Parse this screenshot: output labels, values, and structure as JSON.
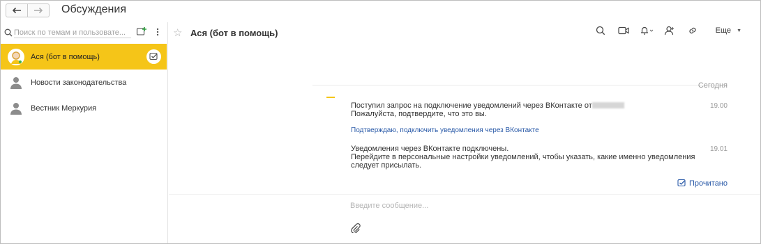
{
  "window": {
    "title": "Обсуждения",
    "back_label": "🡐",
    "forward_label": "🡒"
  },
  "sidebar": {
    "search_placeholder": "Поиск по темам и пользовате...",
    "conversations": [
      {
        "name": "Ася (бот в помощь)",
        "active": true
      },
      {
        "name": "Новости законодательства",
        "active": false
      },
      {
        "name": "Вестник Меркурия",
        "active": false
      }
    ]
  },
  "chat": {
    "title": "Ася (бот в помощь)",
    "more_label": "Еще",
    "date_separator": "Сегодня",
    "messages": [
      {
        "lines": [
          "Поступил запрос на подключение уведомлений через ВКонтакте от",
          "Пожалуйста, подтвердите, что это вы."
        ],
        "time": "19.00"
      },
      {
        "lines": [
          "Уведомления через ВКонтакте подключены.",
          "Перейдите в персональные настройки уведомлений, чтобы указать, какие именно уведомления",
          "следует присылать."
        ],
        "time": "19.01"
      }
    ],
    "confirm_link": "Подтверждаю, подключить уведомления через ВКонтакте",
    "read_status": "Прочитано",
    "compose_placeholder": "Введите сообщение..."
  },
  "colors": {
    "accent_yellow": "#f5c518",
    "link_blue": "#2a5aa8"
  }
}
